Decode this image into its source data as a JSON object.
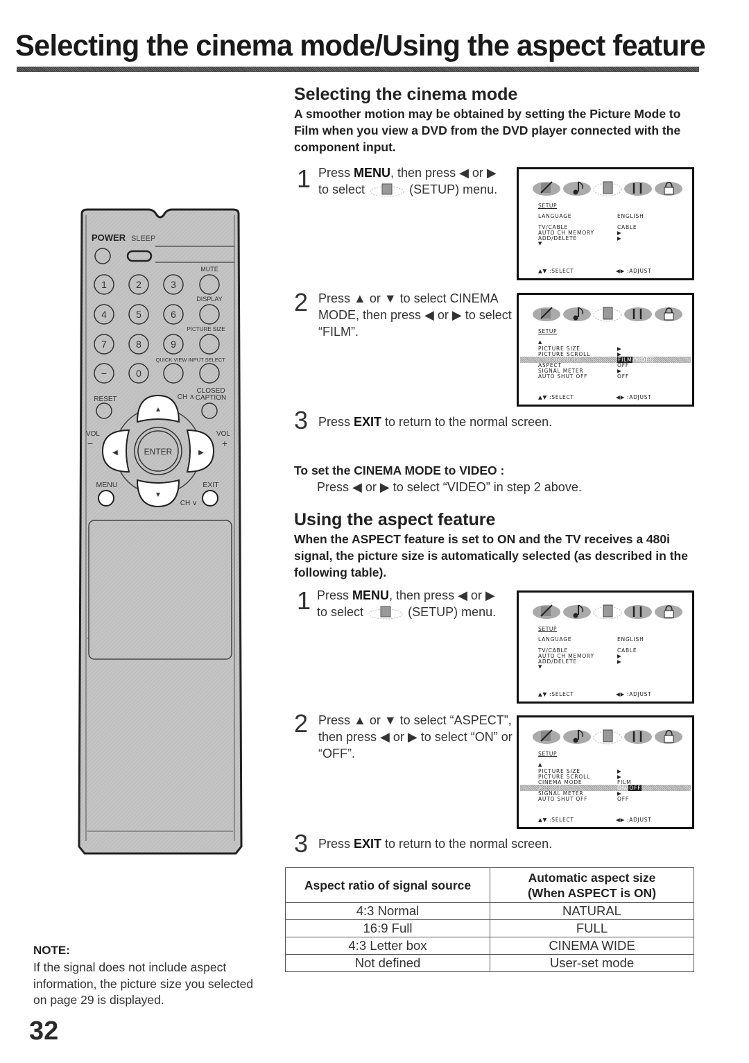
{
  "page": {
    "title": "Selecting the cinema mode/Using the aspect feature",
    "page_number": "32"
  },
  "cinema": {
    "heading": "Selecting the cinema mode",
    "lead": "A smoother motion may be obtained by setting the Picture Mode to Film when you view a DVD from the DVD player connected with the component input.",
    "steps": [
      {
        "num": "1",
        "pre": "Press ",
        "bold": "MENU",
        "post": ", then press ◀ or ▶",
        "line2_pre": "to select",
        "line2_post": "(SETUP) menu."
      },
      {
        "num": "2",
        "text": "Press ▲ or ▼ to select CINEMA MODE, then press ◀ or ▶ to select “FILM”."
      },
      {
        "num": "3",
        "pre": "Press ",
        "bold": "EXIT",
        "post": " to return to the normal screen."
      }
    ],
    "video_heading": "To set the CINEMA MODE to VIDEO :",
    "video_text": "Press ◀ or ▶ to select “VIDEO” in step 2 above."
  },
  "aspect": {
    "heading": "Using the aspect feature",
    "lead": "When the ASPECT feature is set to ON and the TV receives a 480i signal, the picture size is automatically selected (as described in the following table).",
    "steps": [
      {
        "num": "1",
        "pre": "Press ",
        "bold": "MENU",
        "post": ", then press ◀ or ▶",
        "line2_pre": "to select",
        "line2_post": "(SETUP) menu."
      },
      {
        "num": "2",
        "text": "Press ▲ or ▼ to select “ASPECT”, then press ◀ or ▶ to select “ON” or “OFF”."
      },
      {
        "num": "3",
        "pre": "Press ",
        "bold": "EXIT",
        "post": " to return to the normal screen."
      }
    ]
  },
  "osd": {
    "title": "SETUP",
    "footer_select": "▲▼ :SELECT",
    "footer_adjust": "◀▶ :ADJUST",
    "icons": [
      "picture-icon",
      "audio-icon",
      "setup-icon",
      "tools-icon",
      "lock-icon"
    ],
    "screen1": {
      "rows": [
        {
          "label": "LANGUAGE",
          "value": "ENGLISH"
        },
        {
          "label": "TV/CABLE",
          "value": "CABLE"
        },
        {
          "label": "AUTO CH MEMORY",
          "value": "▶"
        },
        {
          "label": "ADD/DELETE",
          "value": "▶"
        }
      ],
      "more": "▼"
    },
    "screen2": {
      "up": "▲",
      "rows": [
        {
          "label": "PICTURE SIZE",
          "value": "▶"
        },
        {
          "label": "PICTURE SCROLL",
          "value": "▶"
        },
        {
          "label": "CINEMA MODE",
          "value_selected": "FILM",
          "value_rest": "/VIDEO",
          "highlight": true
        },
        {
          "label": "ASPECT",
          "value": "OFF"
        },
        {
          "label": "SIGNAL METER",
          "value": "▶"
        },
        {
          "label": "AUTO SHUT OFF",
          "value": "OFF"
        }
      ]
    },
    "screen3": {
      "up": "▲",
      "rows": [
        {
          "label": "PICTURE SIZE",
          "value": "▶"
        },
        {
          "label": "PICTURE SCROLL",
          "value": "▶"
        },
        {
          "label": "CINEMA MODE",
          "value": "FILM"
        },
        {
          "label": "ASPECT",
          "value_rest": "ON/",
          "value_selected": "OFF",
          "highlight": true
        },
        {
          "label": "SIGNAL METER",
          "value": "▶"
        },
        {
          "label": "AUTO SHUT OFF",
          "value": "OFF"
        }
      ]
    }
  },
  "table": {
    "headers": [
      "Aspect ratio of signal source",
      "Automatic aspect size",
      "(When ASPECT is ON)"
    ],
    "rows": [
      [
        "4:3 Normal",
        "NATURAL"
      ],
      [
        "16:9 Full",
        "FULL"
      ],
      [
        "4:3 Letter box",
        "CINEMA WIDE"
      ],
      [
        "Not defined",
        "User-set mode"
      ]
    ]
  },
  "note": {
    "heading": "NOTE:",
    "text": "If the signal does not include aspect information, the picture size you selected on page 29 is displayed."
  },
  "remote": {
    "labels": {
      "power": "POWER",
      "sleep": "SLEEP",
      "mute": "MUTE",
      "display": "DISPLAY",
      "picture_size": "PICTURE SIZE",
      "quick_view": "QUICK VIEW",
      "input_select": "INPUT SELECT",
      "reset": "RESET",
      "ch_up": "CH ∧",
      "closed": "CLOSED",
      "caption": "CAPTION",
      "vol": "VOL",
      "minus": "−",
      "plus": "+",
      "enter": "ENTER",
      "menu": "MENU",
      "exit": "EXIT",
      "ch_down": "CH ∨"
    },
    "digits": [
      "1",
      "2",
      "3",
      "4",
      "5",
      "6",
      "7",
      "8",
      "9",
      "−",
      "0"
    ]
  }
}
